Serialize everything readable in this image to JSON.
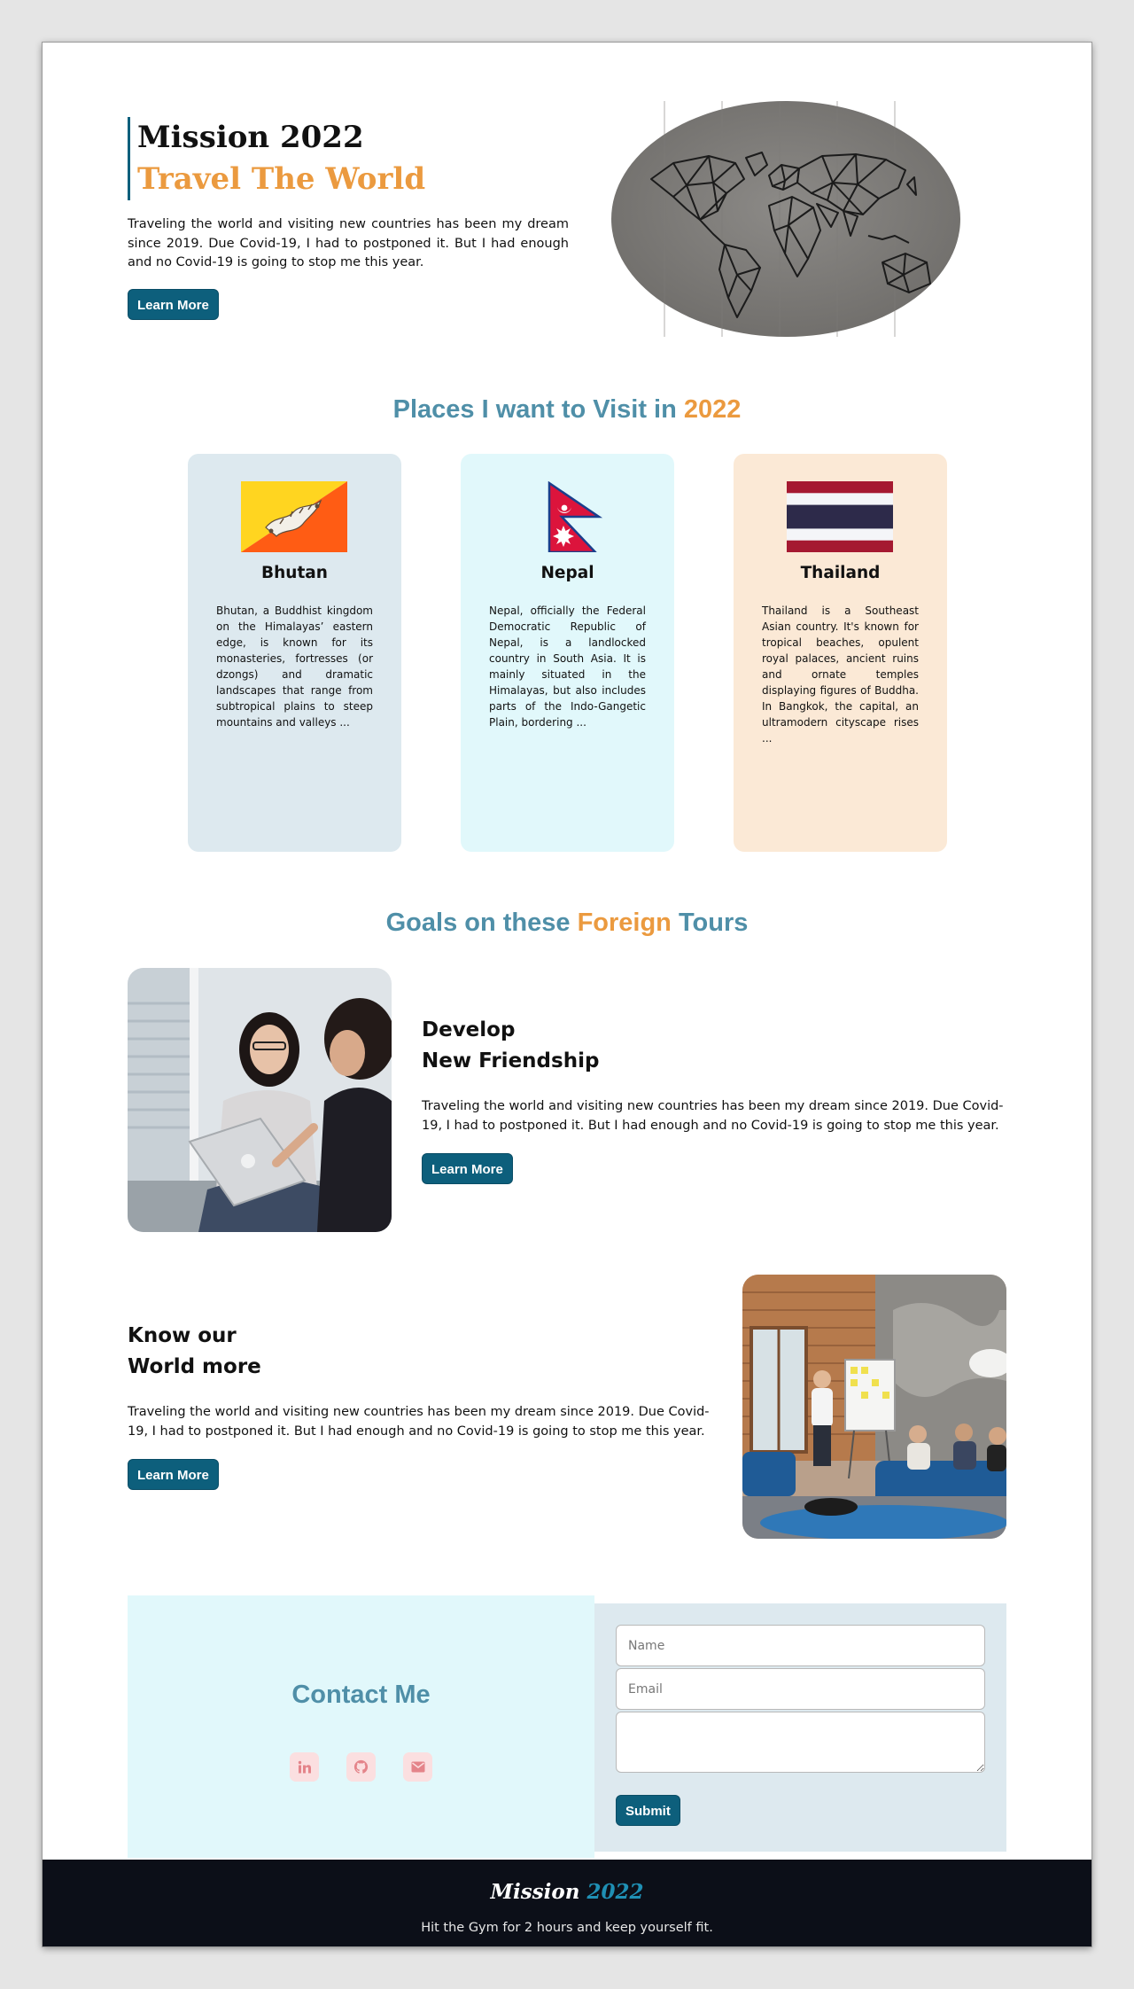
{
  "hero": {
    "title": "Mission 2022",
    "subtitle": "Travel The World",
    "text": "Traveling the world and visiting new countries has been my dream since 2019. Due Covid-19, I had to postponed it. But I had enough and no Covid-19 is going to stop me this year.",
    "button": "Learn More"
  },
  "places": {
    "heading_main": "Places I want to Visit in ",
    "heading_accent": "2022",
    "cards": [
      {
        "title": "Bhutan",
        "text": "Bhutan, a Buddhist kingdom on the Himalayas’ eastern edge, is known for its monasteries, fortresses (or dzongs) and dramatic landscapes that range from subtropical plains to steep mountains and valleys ...",
        "bg": "#dde9ef"
      },
      {
        "title": "Nepal",
        "text": "Nepal, officially the Federal Democratic Republic of Nepal, is a landlocked country in South Asia. It is mainly situated in the Himalayas, but also includes parts of the Indo-Gangetic Plain, bordering ...",
        "bg": "#e1f8fb"
      },
      {
        "title": "Thailand",
        "text": "Thailand is a Southeast Asian country. It's known for tropical beaches, opulent royal palaces, ancient ruins and ornate temples displaying figures of Buddha. In Bangkok, the capital, an ultramodern cityscape rises ...",
        "bg": "#fbe9d6"
      }
    ]
  },
  "goals": {
    "heading_part1": "Goals on these ",
    "heading_accent": "Foreign",
    "heading_part2": " Tours",
    "items": [
      {
        "title_line1": "Develop",
        "title_line2": "New Friendship",
        "text": "Traveling the world and visiting new countries has been my dream since 2019. Due Covid-19, I had to postponed it. But I had enough and no Covid-19 is going to stop me this year.",
        "button": "Learn More"
      },
      {
        "title_line1": "Know our",
        "title_line2": "World more",
        "text": "Traveling the world and visiting new countries has been my dream since 2019. Due Covid-19, I had to postponed it. But I had enough and no Covid-19 is going to stop me this year.",
        "button": "Learn More"
      }
    ]
  },
  "contact": {
    "title": "Contact Me",
    "social_icons": [
      "linkedin-icon",
      "github-icon",
      "mail-icon"
    ],
    "name_placeholder": "Name",
    "email_placeholder": "Email",
    "message_placeholder": "",
    "submit": "Submit"
  },
  "footer": {
    "logo_word": "Mission ",
    "logo_year": "2022",
    "tagline": "Hit the Gym for 2 hours and keep yourself fit."
  },
  "colors": {
    "primary": "#0d5f7c",
    "accent": "#eb9a3f",
    "heading_blue": "#4f8fa8",
    "footer_bg": "#0c0f18"
  }
}
